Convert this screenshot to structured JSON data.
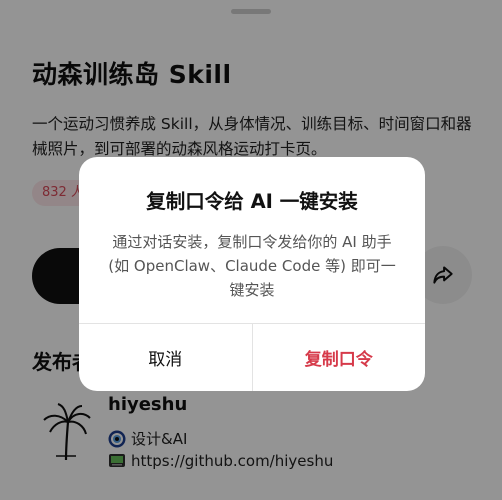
{
  "sheet": {
    "title": "动森训练岛 Skill",
    "description": "一个运动习惯养成 Skill，从身体情况、训练目标、时间窗口和器械照片，到可部署的动森风格运动打卡页。",
    "badge": "832 人",
    "section_label": "发布者",
    "author": {
      "name": "hiyeshu",
      "tags": "设计&AI",
      "link": "https://github.com/hiyeshu"
    }
  },
  "dialog": {
    "title": "复制口令给 AI 一键安装",
    "body": "通过对话安装，复制口令发给你的 AI 助手 (如 OpenClaw、Claude Code 等) 即可一键安装",
    "cancel_label": "取消",
    "confirm_label": "复制口令"
  },
  "icons": {
    "share": "share-arrow-icon",
    "tags": "eye-badge-icon",
    "link": "computer-icon"
  },
  "colors": {
    "accent": "#d63a4a",
    "badge_bg": "#fde7ea",
    "primary_button": "#111111"
  }
}
